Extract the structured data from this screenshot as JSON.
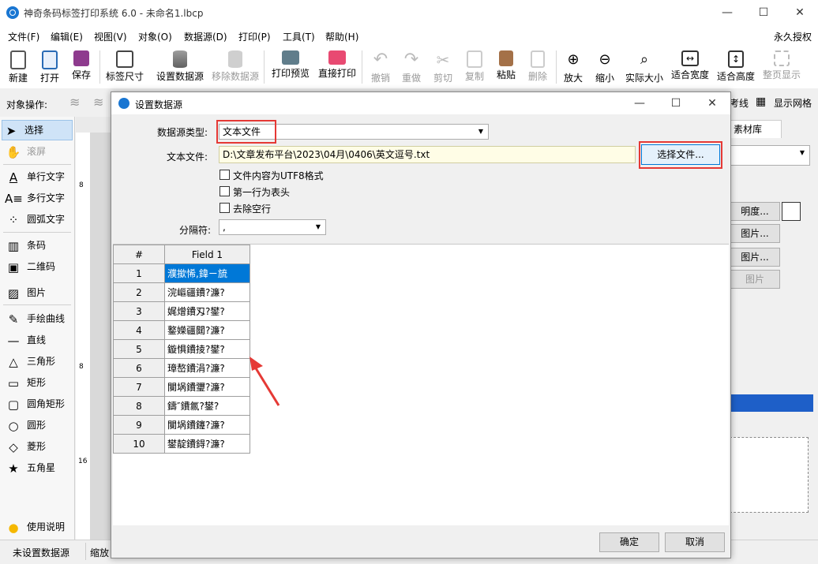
{
  "app": {
    "title": "神奇条码标签打印系统 6.0 - 未命名1.lbcp",
    "license": "永久授权"
  },
  "menu": [
    "文件(F)",
    "编辑(E)",
    "视图(V)",
    "对象(O)",
    "数据源(D)",
    "打印(P)",
    "工具(T)",
    "帮助(H)"
  ],
  "toolbar": {
    "new": "新建",
    "open": "打开",
    "save": "保存",
    "label_size": "标签尺寸",
    "set_datasource": "设置数据源",
    "remove_datasource": "移除数据源",
    "print_preview": "打印预览",
    "direct_print": "直接打印",
    "undo": "撤销",
    "redo": "重做",
    "cut": "剪切",
    "copy": "复制",
    "paste": "粘贴",
    "delete": "删除",
    "zoom_in": "放大",
    "zoom_out": "缩小",
    "actual_size": "实际大小",
    "fit_width": "适合宽度",
    "fit_height": "适合高度",
    "full_page": "整页显示"
  },
  "object_bar": {
    "label": "对象操作:",
    "snap_line": "考线",
    "show_grid": "显示网格"
  },
  "left_panel": {
    "select": "选择",
    "scroll": "滚屏",
    "single_text": "单行文字",
    "multi_text": "多行文字",
    "arc_text": "圆弧文字",
    "barcode": "条码",
    "qrcode": "二维码",
    "image": "图片",
    "freehand": "手绘曲线",
    "line": "直线",
    "triangle": "三角形",
    "rectangle": "矩形",
    "rounded_rect": "圆角矩形",
    "circle": "圆形",
    "diamond": "菱形",
    "star": "五角星",
    "help": "使用说明"
  },
  "ruler": {
    "marks": [
      "8",
      "8",
      "16"
    ]
  },
  "right_panel": {
    "tab": "素材库",
    "transparency": "明度...",
    "image1": "图片...",
    "image2": "图片...",
    "image3": "图片"
  },
  "status": {
    "datasource": "未设置数据源",
    "zoom": "缩放"
  },
  "dialog": {
    "title": "设置数据源",
    "type_label": "数据源类型:",
    "type_value": "文本文件",
    "file_label": "文本文件:",
    "file_path": "D:\\文章发布平台\\2023\\04月\\0406\\英文逗号.txt",
    "choose_file": "选择文件...",
    "utf8": "文件内容为UTF8格式",
    "first_row_header": "第一行为表头",
    "remove_empty": "去除空行",
    "separator_label": "分隔符:",
    "separator_value": ",",
    "ok": "确定",
    "cancel": "取消",
    "grid": {
      "headers": [
        "#",
        "Field 1"
      ],
      "rows": [
        {
          "n": "1",
          "v": "濮撳悕,鍏ㄧ旈"
        },
        {
          "n": "2",
          "v": "浣嶇疆鐨?濂?"
        },
        {
          "n": "3",
          "v": "娓熷鐨刄?鐢?"
        },
        {
          "n": "4",
          "v": "鐜嬫疆閮?濂?"
        },
        {
          "n": "5",
          "v": "鏇惧鐨掕?鐢?"
        },
        {
          "n": "6",
          "v": "璋嶅鐨涓?濂?"
        },
        {
          "n": "7",
          "v": "闃埚鐨瓕?濂?"
        },
        {
          "n": "8",
          "v": "鑄″鐨氱?鐢?"
        },
        {
          "n": "9",
          "v": "闃埚鐨鑳?濂?"
        },
        {
          "n": "10",
          "v": "鐢靛鐨鍀?濂?"
        }
      ]
    }
  },
  "colors": {
    "accent": "#0078d7",
    "highlight_red": "#e53935",
    "arrow_red": "#e53935"
  }
}
